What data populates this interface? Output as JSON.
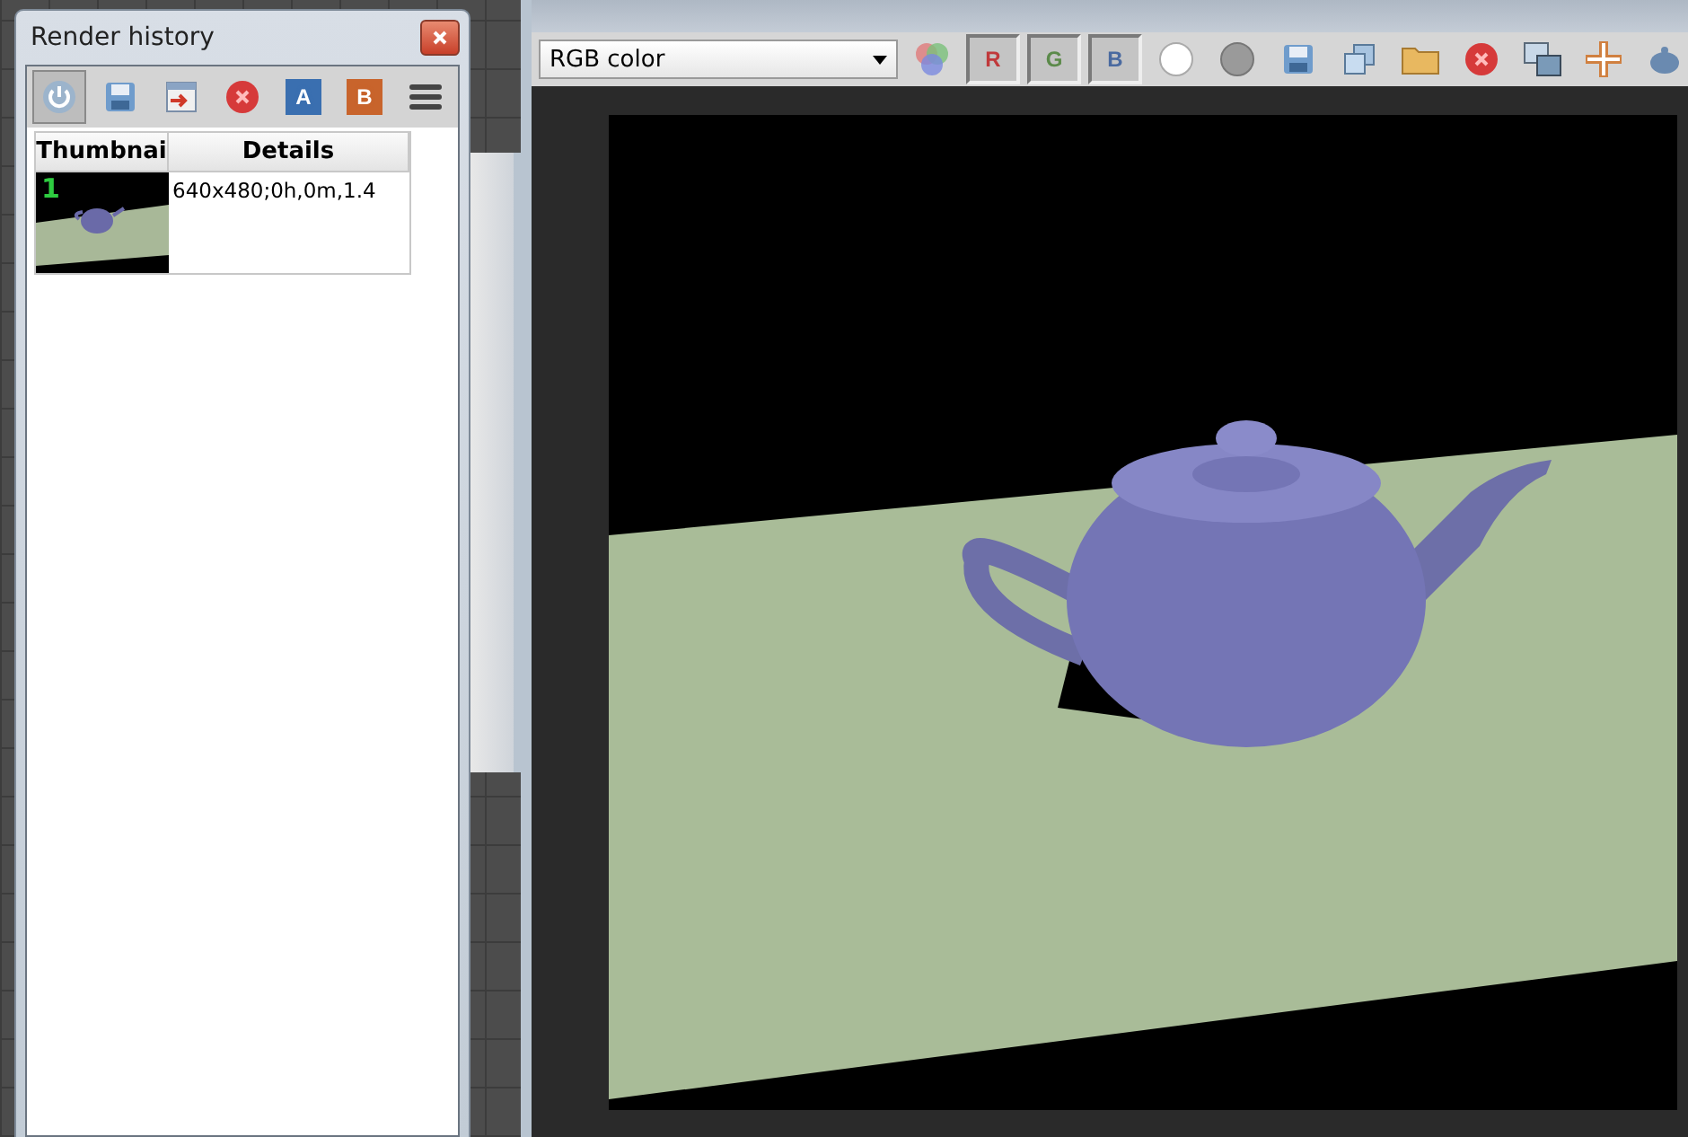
{
  "history_window": {
    "title": "Render history",
    "toolbar": [
      {
        "kind": "power",
        "selected": true
      },
      {
        "kind": "save",
        "selected": false
      },
      {
        "kind": "load",
        "selected": false
      },
      {
        "kind": "delete",
        "selected": false
      },
      {
        "kind": "letter",
        "label": "A",
        "color": "#3a6fb0",
        "selected": false
      },
      {
        "kind": "letter",
        "label": "B",
        "color": "#c8642c",
        "selected": false
      },
      {
        "kind": "menu",
        "selected": false
      }
    ],
    "table": {
      "columns": [
        "Thumbnai",
        "Details"
      ],
      "rows": [
        {
          "number": "1",
          "details": "640x480;0h,0m,1.4"
        }
      ]
    }
  },
  "frame_buffer": {
    "channel_select": "RGB color",
    "channels": [
      {
        "label": "R",
        "color": "#c0393b",
        "selected": true
      },
      {
        "label": "G",
        "color": "#5b8a4a",
        "selected": true
      },
      {
        "label": "B",
        "color": "#4a6aa0",
        "selected": true
      }
    ],
    "tools": [
      {
        "kind": "white-dot"
      },
      {
        "kind": "gray-dot"
      },
      {
        "kind": "save"
      },
      {
        "kind": "copy"
      },
      {
        "kind": "folder"
      },
      {
        "kind": "clear"
      },
      {
        "kind": "windows"
      },
      {
        "kind": "move"
      },
      {
        "kind": "teapot"
      }
    ]
  }
}
